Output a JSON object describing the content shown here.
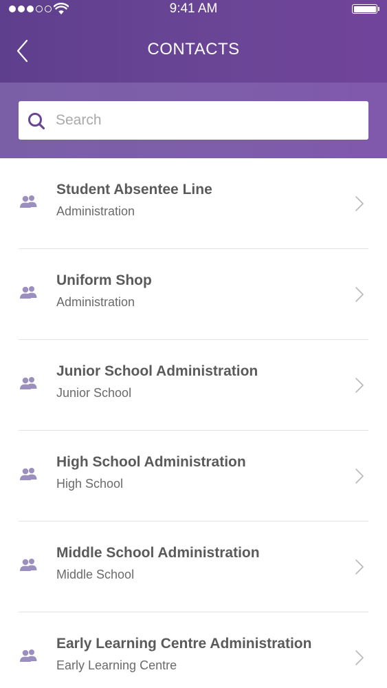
{
  "status_bar": {
    "time": "9:41 AM",
    "signal_bars_filled": 3,
    "signal_bars_total": 5
  },
  "nav": {
    "title": "CONTACTS",
    "back_icon": "chevron-left-icon"
  },
  "search": {
    "placeholder": "Search",
    "value": "",
    "icon": "search-icon"
  },
  "contacts": [
    {
      "name": "Student Absentee Line",
      "department": "Administration"
    },
    {
      "name": "Uniform Shop",
      "department": "Administration"
    },
    {
      "name": "Junior School Administration",
      "department": "Junior School"
    },
    {
      "name": "High School Administration",
      "department": "High School"
    },
    {
      "name": "Middle School Administration",
      "department": "Middle School"
    },
    {
      "name": "Early Learning Centre Administration",
      "department": "Early Learning Centre"
    }
  ],
  "colors": {
    "header_primary": "#6a4596",
    "header_secondary": "#7e5eaa",
    "accent_icon": "#9b8fc0",
    "chevron": "#b8b8b8"
  }
}
